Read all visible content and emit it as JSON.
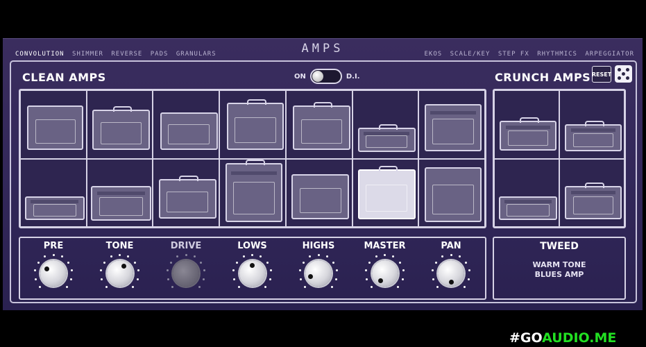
{
  "header": {
    "title": "AMPS",
    "nav_left": [
      "CONVOLUTION",
      "SHIMMER",
      "REVERSE",
      "PADS",
      "GRANULARS"
    ],
    "nav_right": [
      "EKOS",
      "SCALE/KEY",
      "STEP FX",
      "RHYTHMICS",
      "ARPEGGIATOR"
    ],
    "active_tab": "CONVOLUTION"
  },
  "sections": {
    "clean_title": "CLEAN AMPS",
    "crunch_title": "CRUNCH AMPS"
  },
  "di": {
    "on_label": "ON",
    "di_label": "D.I.",
    "state": "on"
  },
  "controls": {
    "reset_label": "RESET",
    "dice_icon": "dice-icon"
  },
  "clean_amps_count": 14,
  "crunch_amps_count": 4,
  "selected_amp": {
    "section": "clean",
    "index": 12
  },
  "knobs": [
    {
      "label": "PRE",
      "active": true
    },
    {
      "label": "TONE",
      "active": true
    },
    {
      "label": "DRIVE",
      "active": false
    },
    {
      "label": "LOWS",
      "active": true
    },
    {
      "label": "HIGHS",
      "active": true
    },
    {
      "label": "MASTER",
      "active": true
    },
    {
      "label": "PAN",
      "active": true
    }
  ],
  "info": {
    "name": "TWEED",
    "desc_line1": "WARM TONE",
    "desc_line2": "BLUES AMP"
  },
  "watermark": {
    "part1": "#GO",
    "part2": "AUDIO.ME"
  }
}
